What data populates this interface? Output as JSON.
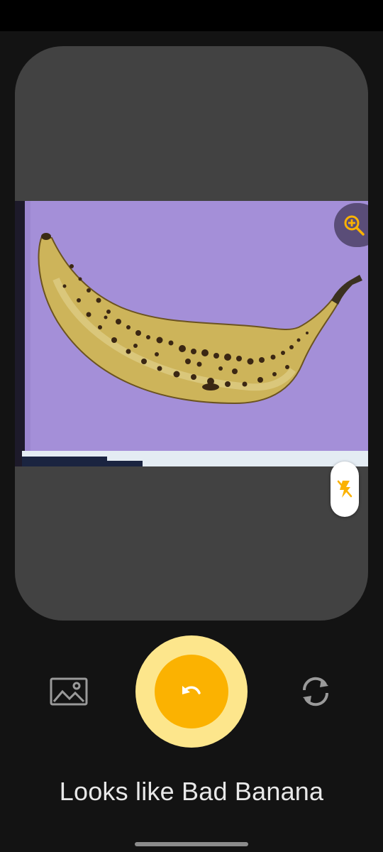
{
  "app": {
    "result_text": "Looks like Bad Banana",
    "photo_url_caption": "https://www.shutterstock.com/image-photo/rotten-ban"
  },
  "icons": {
    "zoom": "zoom-in-icon",
    "flash": "flash-off-icon",
    "gallery": "gallery-icon",
    "capture": "undo-icon",
    "switch_camera": "switch-camera-icon"
  },
  "colors": {
    "accent": "#fbb201",
    "accent_light": "#fde68c",
    "background": "#131313",
    "viewfinder": "#424242"
  }
}
